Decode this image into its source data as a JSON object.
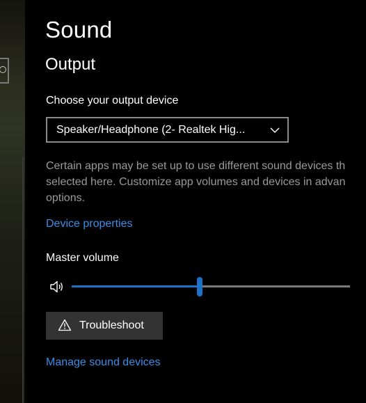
{
  "page": {
    "title": "Sound",
    "section_title": "Output"
  },
  "output": {
    "choose_label": "Choose your output device",
    "selected_device": "Speaker/Headphone (2- Realtek Hig...",
    "description_lines": [
      "Certain apps may be set up to use different sound devices th",
      "selected here. Customize app volumes and devices in advan",
      "options."
    ],
    "device_properties_link": "Device properties",
    "master_volume_label": "Master volume",
    "master_volume_fraction": 0.46,
    "troubleshoot_label": "Troubleshoot",
    "manage_devices_link": "Manage sound devices"
  },
  "icons": {
    "dropdown": "chevron-down-icon",
    "volume": "speaker-icon",
    "troubleshoot": "warning-icon",
    "search": "search-icon"
  },
  "colors": {
    "background": "#000000",
    "accent": "#1a73c8",
    "link": "#3a8ee6",
    "secondary_text": "#9a9a9a",
    "button_bg": "#333333"
  }
}
